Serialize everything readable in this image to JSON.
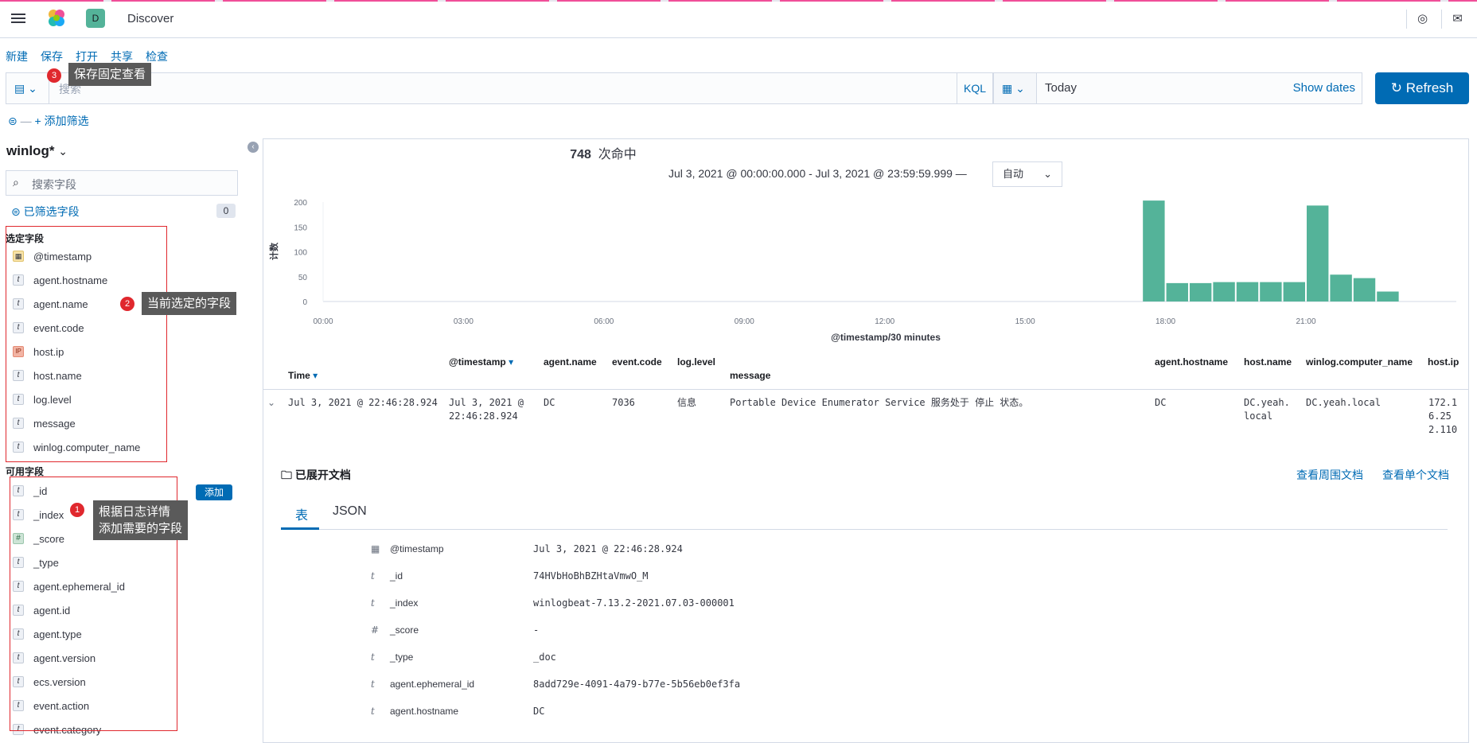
{
  "header": {
    "app_title": "Discover",
    "space_badge": "D",
    "colors": {
      "accent": "#006bb4",
      "brand_pink": "#f04e98",
      "bar": "#54b399"
    }
  },
  "topmenu": [
    "新建",
    "保存",
    "打开",
    "共享",
    "检查"
  ],
  "query": {
    "placeholder": "搜索",
    "kql": "KQL"
  },
  "date": {
    "value": "Today",
    "show_dates": "Show dates"
  },
  "refresh_label": "Refresh",
  "add_filter": "+ 添加筛选",
  "callouts": [
    {
      "num": "3",
      "text": "保存固定查看"
    },
    {
      "num": "2",
      "text": "当前选定的字段"
    },
    {
      "num": "1",
      "text": "根据日志详情\n添加需要的字段"
    }
  ],
  "sidebar": {
    "index_pattern": "winlog*",
    "search_placeholder": "搜索字段",
    "filtered_label": "已筛选字段",
    "filtered_count": "0",
    "selected_heading": "选定字段",
    "selected_fields": [
      {
        "type": "date",
        "name": "@timestamp"
      },
      {
        "type": "t",
        "name": "agent.hostname"
      },
      {
        "type": "t",
        "name": "agent.name"
      },
      {
        "type": "t",
        "name": "event.code"
      },
      {
        "type": "ip",
        "name": "host.ip"
      },
      {
        "type": "t",
        "name": "host.name"
      },
      {
        "type": "t",
        "name": "log.level"
      },
      {
        "type": "t",
        "name": "message"
      },
      {
        "type": "t",
        "name": "winlog.computer_name"
      }
    ],
    "available_heading": "可用字段",
    "add_button": "添加",
    "available_fields": [
      {
        "type": "t",
        "name": "_id"
      },
      {
        "type": "t",
        "name": "_index"
      },
      {
        "type": "num",
        "name": "_score"
      },
      {
        "type": "t",
        "name": "_type"
      },
      {
        "type": "t",
        "name": "agent.ephemeral_id"
      },
      {
        "type": "t",
        "name": "agent.id"
      },
      {
        "type": "t",
        "name": "agent.type"
      },
      {
        "type": "t",
        "name": "agent.version"
      },
      {
        "type": "t",
        "name": "ecs.version"
      },
      {
        "type": "t",
        "name": "event.action"
      },
      {
        "type": "t",
        "name": "event.category"
      }
    ]
  },
  "hits": {
    "count": "748",
    "label": "次命中"
  },
  "date_range": "Jul 3, 2021 @ 00:00:00.000 - Jul 3, 2021 @ 23:59:59.999 —",
  "interval": "自动",
  "chart_data": {
    "type": "bar",
    "ylabel": "计数",
    "xlabel": "@timestamp/30 minutes",
    "ylim": [
      0,
      200
    ],
    "yticks": [
      "200",
      "150",
      "100",
      "50",
      "0"
    ],
    "xticks": [
      "00:00",
      "03:00",
      "06:00",
      "09:00",
      "12:00",
      "15:00",
      "18:00",
      "21:00"
    ],
    "bins": [
      "17:30",
      "18:00",
      "18:30",
      "19:00",
      "19:30",
      "20:00",
      "20:30",
      "21:00",
      "21:30",
      "22:00",
      "22:30"
    ],
    "values": [
      203,
      37,
      37,
      39,
      39,
      39,
      39,
      193,
      54,
      47,
      20
    ]
  },
  "table": {
    "headers": {
      "time": "Time",
      "timestamp": "@timestamp",
      "agent_name": "agent.name",
      "event_code": "event.code",
      "log_level": "log.level",
      "message": "message",
      "agent_hostname": "agent.hostname",
      "host_name": "host.name",
      "computer_name": "winlog.computer_name",
      "host_ip": "host.ip"
    },
    "row": {
      "time": "Jul 3, 2021 @ 22:46:28.924",
      "timestamp": "Jul 3, 2021 @\n22:46:28.924",
      "agent_name": "DC",
      "event_code": "7036",
      "log_level": "信息",
      "message": "Portable Device Enumerator Service 服务处于 停止 状态。",
      "agent_hostname": "DC",
      "host_name": "DC.yeah.\nlocal",
      "computer_name": "DC.yeah.local",
      "host_ip": "172.1\n6.25\n2.110"
    }
  },
  "doc": {
    "title": "已展开文档",
    "link_surrounding": "查看周围文档",
    "link_single": "查看单个文档",
    "tab_table": "表",
    "tab_json": "JSON",
    "rows": [
      {
        "type": "date",
        "key": "@timestamp",
        "value": "Jul 3, 2021 @ 22:46:28.924"
      },
      {
        "type": "t",
        "key": "_id",
        "value": "74HVbHoBhBZHtaVmwO_M"
      },
      {
        "type": "t",
        "key": "_index",
        "value": "winlogbeat-7.13.2-2021.07.03-000001"
      },
      {
        "type": "#",
        "key": "_score",
        "value": " -"
      },
      {
        "type": "t",
        "key": "_type",
        "value": "_doc"
      },
      {
        "type": "t",
        "key": "agent.ephemeral_id",
        "value": "8add729e-4091-4a79-b77e-5b56eb0ef3fa"
      },
      {
        "type": "t",
        "key": "agent.hostname",
        "value": "DC"
      }
    ]
  }
}
